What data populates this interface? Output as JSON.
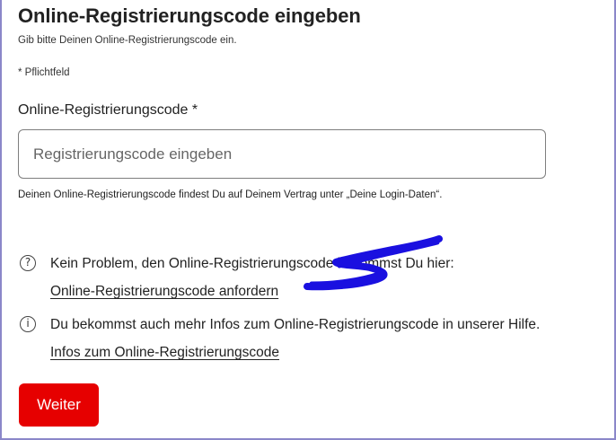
{
  "header": {
    "title": "Online-Registrierungscode eingeben",
    "subtitle": "Gib bitte Deinen Online-Registrierungscode ein."
  },
  "form": {
    "required_note": "* Pflichtfeld",
    "code_label": "Online-Registrierungscode *",
    "code_placeholder": "Registrierungscode eingeben",
    "code_value": "",
    "hint": "Deinen Online-Registrierungscode findest Du auf Deinem Vertrag unter „Deine Login-Daten“.",
    "submit_label": "Weiter"
  },
  "info": [
    {
      "icon": "question-circle-icon",
      "icon_glyph": "?",
      "text": "Kein Problem, den Online-Registrierungscode bekommst Du hier:",
      "link": "Online-Registrierungscode anfordern"
    },
    {
      "icon": "info-circle-icon",
      "icon_glyph": "i",
      "text": "Du bekommst auch mehr Infos zum Online-Registrierungscode in unserer Hilfe.",
      "link": "Infos zum Online-Registrierungscode"
    }
  ],
  "colors": {
    "primary_button": "#e60000",
    "annotation_ink": "#1a10e0",
    "frame_border": "#8b87c9"
  }
}
